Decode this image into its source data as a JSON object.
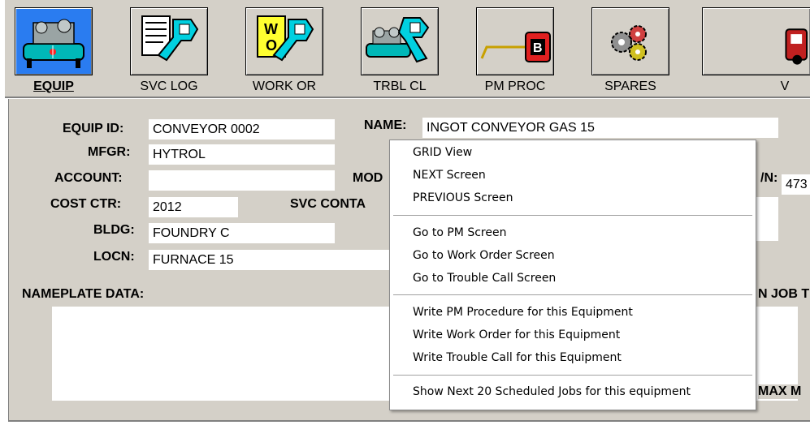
{
  "toolbar": {
    "buttons": [
      {
        "label": "EQUIP",
        "icon": "compressor-icon"
      },
      {
        "label": "SVC LOG",
        "icon": "service-log-wrench-icon"
      },
      {
        "label": "WORK OR",
        "icon": "work-order-wrench-icon"
      },
      {
        "label": "TRBL CL",
        "icon": "trouble-call-wrench-icon"
      },
      {
        "label": "PM PROC",
        "icon": "pm-procedure-icon"
      },
      {
        "label": "SPARES",
        "icon": "gears-icon"
      },
      {
        "label": "V",
        "icon": "vehicle-icon"
      }
    ],
    "pm_badge": "B"
  },
  "form": {
    "equip_id": {
      "label": "EQUIP ID:",
      "value": "CONVEYOR 0002"
    },
    "mfgr": {
      "label": "MFGR:",
      "value": "HYTROL"
    },
    "account": {
      "label": "ACCOUNT:",
      "value": ""
    },
    "cost_ctr": {
      "label": "COST CTR:",
      "value": "2012"
    },
    "bldg": {
      "label": "BLDG:",
      "value": "FOUNDRY C"
    },
    "locn": {
      "label": "LOCN:",
      "value": "FURNACE 15"
    },
    "name": {
      "label": "NAME:",
      "value": "INGOT CONVEYOR GAS 15"
    },
    "model_partial": "MOD",
    "svc_contact_partial": "SVC CONTA",
    "sn_partial": {
      "label": "/N:",
      "value": "473"
    },
    "nameplate": {
      "label": "NAMEPLATE DATA:"
    },
    "job_partial": "N JOB T",
    "max_partial": "MAX M"
  },
  "context_menu": {
    "items": [
      "GRID View",
      "NEXT Screen",
      "PREVIOUS Screen",
      "Go to PM Screen",
      "Go to Work Order Screen",
      "Go to Trouble Call Screen",
      "Write PM Procedure for this Equipment",
      "Write Work Order for this Equipment",
      "Write Trouble Call for this Equipment",
      "Show Next 20 Scheduled Jobs for this equipment"
    ]
  }
}
